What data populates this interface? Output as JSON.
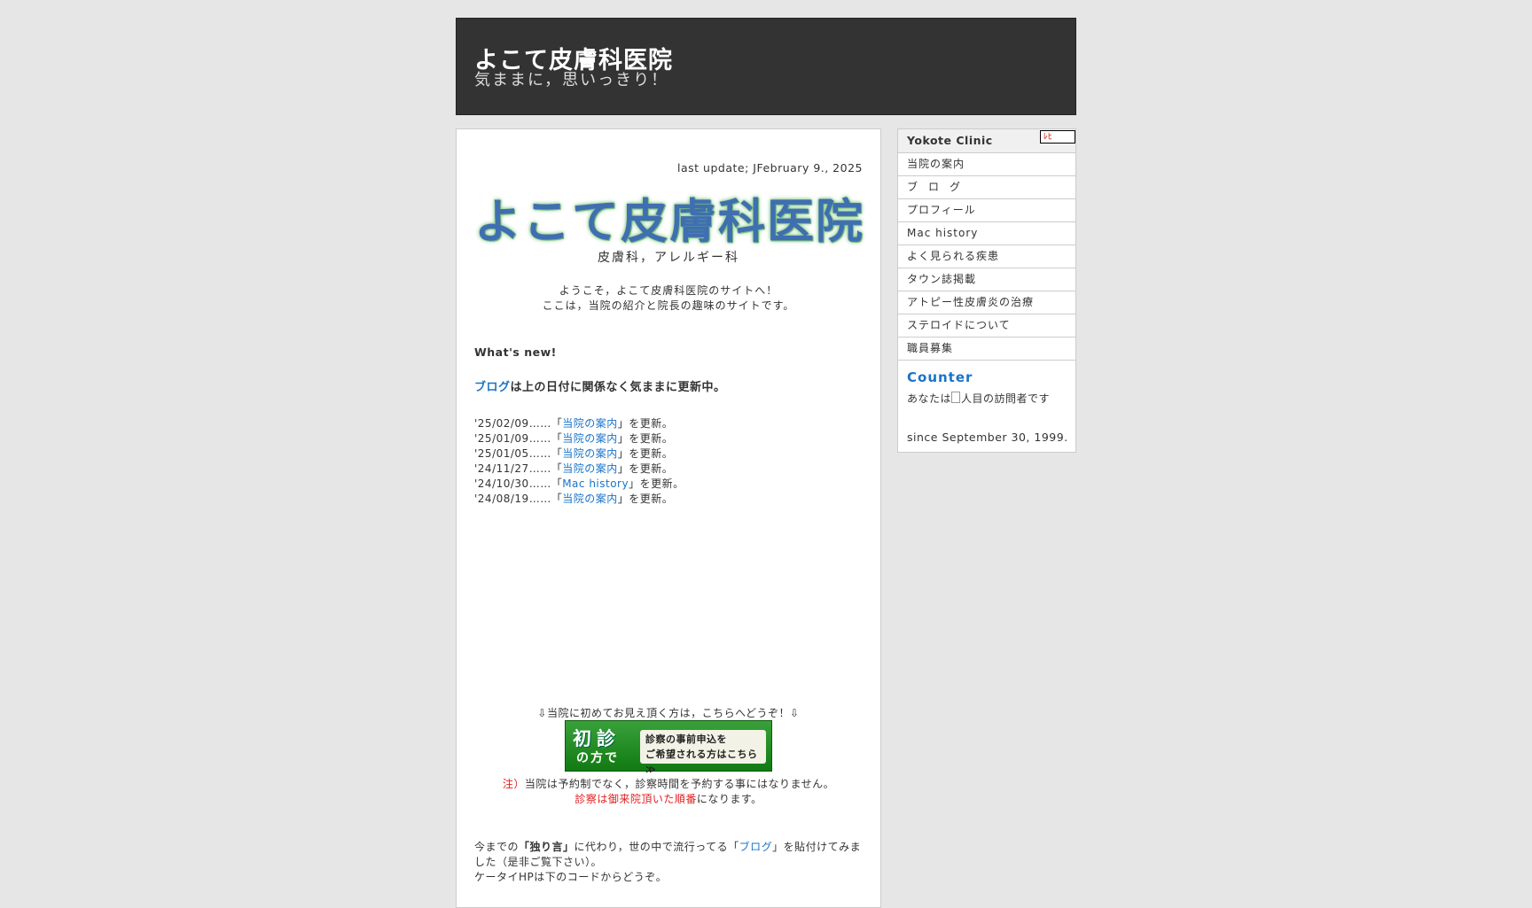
{
  "header": {
    "title": "よこて皮膚科医院",
    "subtitle": "気ままに，思いっきり！"
  },
  "main": {
    "last_update": "last update; JFebruary 9., 2025",
    "logo_text": "よこて皮膚科医院",
    "departments": "皮膚科，アレルギー科",
    "welcome_line1": "ようこそ，よこて皮膚科医院のサイトへ！",
    "welcome_line2": "ここは，当院の紹介と院長の趣味のサイトです。",
    "whats_new": "What's new!",
    "blog_link": "ブログ",
    "blog_lead_rest": "は上の日付に関係なく気ままに更新中。",
    "updates": [
      {
        "date": "'25/02/09……「",
        "link": "当院の案内",
        "suffix": "」を更新。"
      },
      {
        "date": "'25/01/09……「",
        "link": "当院の案内",
        "suffix": "」を更新。"
      },
      {
        "date": "'25/01/05……「",
        "link": "当院の案内",
        "suffix": "」を更新。"
      },
      {
        "date": "'24/11/27……「",
        "link": "当院の案内",
        "suffix": "」を更新。"
      },
      {
        "date": "'24/10/30……「",
        "link": "Mac history",
        "suffix": "」を更新。"
      },
      {
        "date": "'24/08/19……「",
        "link": "当院の案内",
        "suffix": "」を更新。"
      }
    ],
    "first_visit_lead": "⇩当院に初めてお見え頂く方は，こちらへどうぞ！⇩",
    "first_visit_button": {
      "big": "初診",
      "small": "の方で",
      "line1": "診察の事前申込を",
      "line2": "ご希望される方はこちら ≫"
    },
    "note_label": "注）",
    "note_text": "当院は予約制でなく，診察時間を予約する事にはなりません。",
    "note2_red": "診察は御来院頂いた順番",
    "note2_rest": "になります。",
    "bottom": {
      "part1": "今までの",
      "bold": "「独り言」",
      "part2": "に代わり，世の中で流行ってる「",
      "link": "ブログ",
      "part3": "」を貼付けてみました（是非ご覧下さい）。",
      "line2": "ケータイHPは下のコードからどうぞ。"
    }
  },
  "sidebar": {
    "header": "Yokote Clinic",
    "mini_badge": "ﾚﾋ",
    "items": [
      "当院の案内",
      "ブログ",
      "プロフィール",
      "Mac history",
      "よく見られる疾患",
      "タウン誌掲載",
      "アトピー性皮膚炎の治療",
      "ステロイドについて",
      "職員募集"
    ],
    "counter_title": "Counter",
    "counter_prefix": "あなたは",
    "counter_img_alt": "人目の訪問者です",
    "since": "since September 30, 1999."
  }
}
